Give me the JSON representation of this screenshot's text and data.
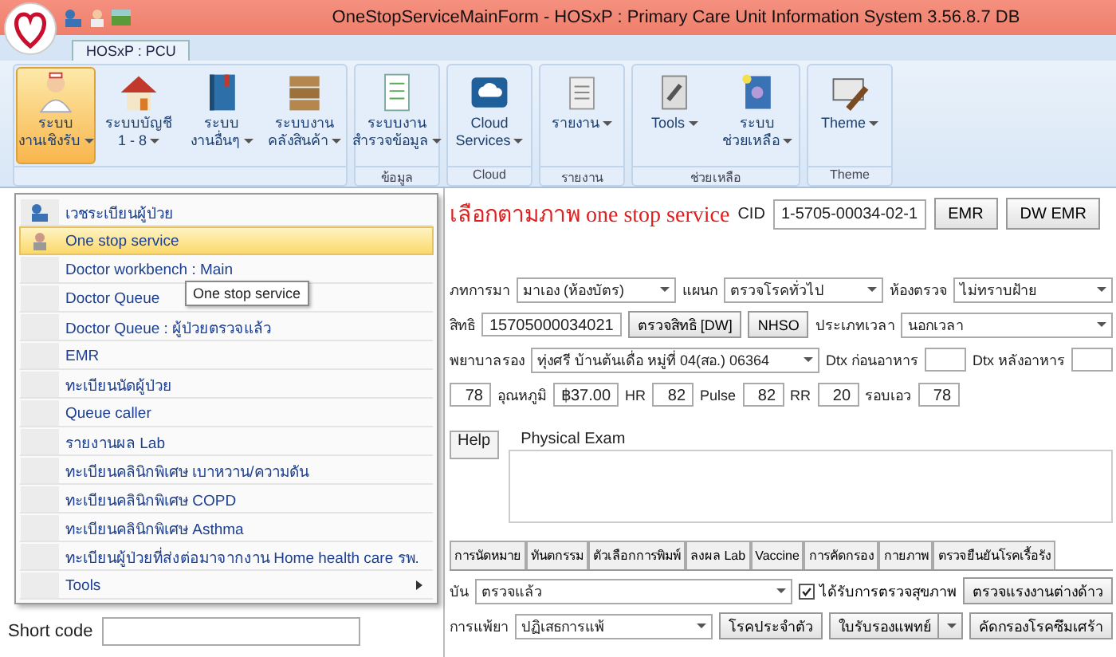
{
  "window": {
    "title": "OneStopServiceMainForm -  HOSxP : Primary Care Unit Information System 3.56.8.7 DB"
  },
  "app_tab": {
    "label": "HOSxP : PCU",
    "selected": true
  },
  "ribbon": {
    "groups": [
      {
        "buttons": [
          {
            "label": "ระบบ\nงานเชิงรับ",
            "dropdown": true,
            "selected": true
          },
          {
            "label": "ระบบบัญชี\n1 - 8",
            "dropdown": true,
            "selected": false
          },
          {
            "label": "ระบบ\nงานอื่นๆ",
            "dropdown": true,
            "selected": false
          },
          {
            "label": "ระบบงาน\nคลังสินค้า",
            "dropdown": true,
            "selected": false
          }
        ]
      },
      {
        "label": "ข้อมูล",
        "buttons": [
          {
            "label": "ระบบงาน\nสำรวจข้อมูล",
            "dropdown": true,
            "selected": false
          }
        ]
      },
      {
        "label": "Cloud",
        "buttons": [
          {
            "label": "Cloud\nServices",
            "dropdown": true,
            "selected": false
          }
        ]
      },
      {
        "label": "รายงาน",
        "buttons": [
          {
            "label": "รายงาน",
            "dropdown": true,
            "selected": false
          }
        ]
      },
      {
        "label": "ช่วยเหลือ",
        "buttons": [
          {
            "label": "Tools",
            "dropdown": true,
            "selected": false
          },
          {
            "label": "ระบบ\nช่วยเหลือ",
            "dropdown": true,
            "selected": false
          }
        ]
      },
      {
        "label": "Theme",
        "buttons": [
          {
            "label": "Theme",
            "dropdown": true,
            "selected": false
          }
        ]
      }
    ]
  },
  "menu": {
    "items": [
      {
        "kind": "item",
        "label": "เวชระเบียนผู้ป่วย",
        "selected": false
      },
      {
        "kind": "item",
        "label": "One stop service",
        "selected": true
      },
      {
        "kind": "item",
        "label": "Doctor workbench : Main",
        "selected": false
      },
      {
        "kind": "item",
        "label": "Doctor Queue",
        "selected": false
      },
      {
        "kind": "item",
        "label": "Doctor Queue : ผู้ป่วยตรวจแล้ว",
        "selected": false
      },
      {
        "kind": "item",
        "label": "EMR",
        "selected": false
      },
      {
        "kind": "item",
        "label": "ทะเบียนนัดผู้ป่วย",
        "selected": false
      },
      {
        "kind": "item",
        "label": "Queue caller",
        "selected": false
      },
      {
        "kind": "item",
        "label": "รายงานผล Lab",
        "selected": false
      },
      {
        "kind": "item",
        "label": "ทะเบียนคลินิกพิเศษ เบาหวาน/ความดัน",
        "selected": false
      },
      {
        "kind": "item",
        "label": "ทะเบียนคลินิกพิเศษ COPD",
        "selected": false
      },
      {
        "kind": "item",
        "label": "ทะเบียนคลินิกพิเศษ Asthma",
        "selected": false
      },
      {
        "kind": "item",
        "label": "ทะเบียนผู้ป่วยที่ส่งต่อมาจากงาน Home health care รพ.",
        "selected": false
      },
      {
        "kind": "submenu",
        "label": "Tools",
        "selected": false
      }
    ]
  },
  "tooltip": "One stop service",
  "annotation": "เลือกตามภาพ one stop service",
  "form": {
    "cid_label": "CID",
    "cid": "1-5705-00034-02-1",
    "buttons": [
      "EMR",
      "DW EMR"
    ],
    "rows": [
      {
        "items": [
          {
            "kind": "label",
            "text": "ภทการมา"
          },
          {
            "kind": "select",
            "value": "มาเอง (ห้องบัตร)"
          },
          {
            "kind": "label",
            "text": "แผนก"
          },
          {
            "kind": "select",
            "value": "ตรวจโรคทั่วไป"
          },
          {
            "kind": "label",
            "text": "ห้องตรวจ"
          },
          {
            "kind": "select",
            "value": "ไม่ทราบฝ้าย"
          }
        ]
      },
      {
        "items": [
          {
            "kind": "label",
            "text": "สิทธิ"
          },
          {
            "kind": "field",
            "value": "15705000034021"
          },
          {
            "kind": "button",
            "label": "ตรวจสิทธิ [DW]"
          },
          {
            "kind": "button",
            "label": "NHSO"
          },
          {
            "kind": "label",
            "text": "ประเภทเวลา"
          },
          {
            "kind": "select",
            "value": "นอกเวลา"
          }
        ]
      },
      {
        "items": [
          {
            "kind": "label",
            "text": "พยาบาลรอง"
          },
          {
            "kind": "select",
            "value": "ทุ่งศรี บ้านต้นเดื่อ หมู่ที่ 04(สอ.) 06364"
          },
          {
            "kind": "label",
            "text": "Dtx ก่อนอาหาร"
          },
          {
            "kind": "field"
          },
          {
            "kind": "label",
            "text": "Dtx หลังอาหาร"
          },
          {
            "kind": "field"
          }
        ]
      },
      {
        "items": [
          {
            "kind": "field",
            "value": "78"
          },
          {
            "kind": "label",
            "text": "อุณหภูมิ"
          },
          {
            "kind": "field",
            "value": "฿37.00"
          },
          {
            "kind": "label",
            "text": "HR"
          },
          {
            "kind": "field",
            "value": "82"
          },
          {
            "kind": "label",
            "text": "Pulse"
          },
          {
            "kind": "field",
            "value": "82"
          },
          {
            "kind": "label",
            "text": "RR"
          },
          {
            "kind": "field",
            "value": "20"
          },
          {
            "kind": "label",
            "text": "รอบเอว"
          },
          {
            "kind": "field",
            "value": "78"
          }
        ]
      }
    ],
    "help_tab": "Help",
    "physical_exam": "Physical Exam",
    "tabs": [
      {
        "label": "การนัดหมาย",
        "selected": false
      },
      {
        "label": "ทันตกรรม",
        "selected": false
      },
      {
        "label": "ตัวเลือกการพิมพ์",
        "selected": false
      },
      {
        "label": "ลงผล Lab",
        "selected": false
      },
      {
        "label": "Vaccine",
        "selected": false
      },
      {
        "label": "การคัดกรอง",
        "selected": false
      },
      {
        "label": "กายภาพ",
        "selected": false
      },
      {
        "label": "ตรวจยืนยันโรคเรื้อรัง",
        "selected": false
      }
    ],
    "bottom_rows": [
      {
        "items": [
          {
            "kind": "label",
            "text": "บัน"
          },
          {
            "kind": "select",
            "value": "ตรวจแล้ว"
          },
          {
            "kind": "checkbox",
            "label": "ได้รับการตรวจสุขภาพ",
            "checked": true
          },
          {
            "kind": "button",
            "label": "ตรวจแรงงานต่างด้าว"
          }
        ]
      },
      {
        "items": [
          {
            "kind": "label",
            "text": "การแพ้ยา"
          },
          {
            "kind": "select",
            "value": "ปฏิเสธการแพ้"
          },
          {
            "kind": "button",
            "label": "โรคประจำตัว"
          },
          {
            "kind": "split_button",
            "label": "ใบรับรองแพทย์"
          },
          {
            "kind": "button",
            "label": "คัดกรองโรคซึมเศร้า"
          }
        ]
      }
    ]
  },
  "short_code": {
    "label": "Short code"
  }
}
